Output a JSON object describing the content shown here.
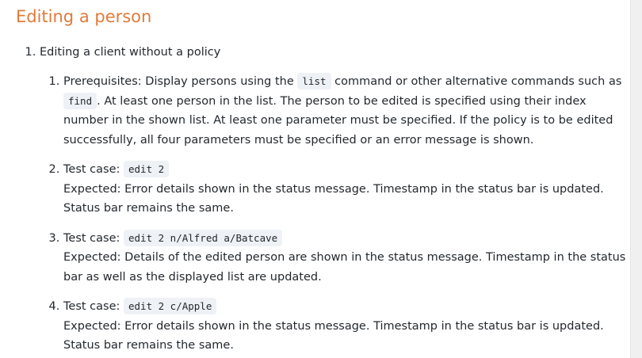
{
  "section": {
    "title": "Editing a person"
  },
  "outer_item": {
    "label": "Editing a client without a policy"
  },
  "items": [
    {
      "text_1": "Prerequisites: Display persons using the ",
      "code_1": "list",
      "text_2": " command or other alternative commands such as ",
      "code_2": "find",
      "text_3": ". At least one person in the list. The person to be edited is specified using their index number in the shown list. At least one parameter must be specified. If the policy is to be edited successfully, all four parameters must be specified or an error message is shown."
    },
    {
      "prefix": "Test case: ",
      "code": "edit 2",
      "expected": "Expected: Error details shown in the status message. Timestamp in the status bar is updated. Status bar remains the same."
    },
    {
      "prefix": "Test case: ",
      "code": "edit 2 n/Alfred a/Batcave",
      "expected": "Expected: Details of the edited person are shown in the status message. Timestamp in the status bar as well as the displayed list are updated."
    },
    {
      "prefix": "Test case: ",
      "code": "edit 2 c/Apple",
      "expected": "Expected: Error details shown in the status message. Timestamp in the status bar is updated. Status bar remains the same."
    }
  ]
}
